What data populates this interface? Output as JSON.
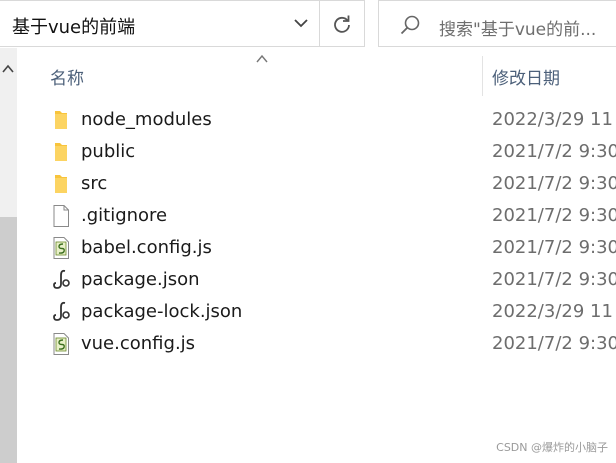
{
  "address_bar": {
    "path": "基于vue的前端",
    "dropdown_icon": "chevron-down-icon",
    "refresh_icon": "refresh-icon"
  },
  "search": {
    "placeholder": "搜索\"基于vue的前...",
    "icon": "search-icon"
  },
  "columns": {
    "name": "名称",
    "date_modified": "修改日期",
    "sorted_by": "name",
    "sort_direction": "ascending"
  },
  "files": [
    {
      "name": "node_modules",
      "date": "2022/3/29 11",
      "type": "folder"
    },
    {
      "name": "public",
      "date": "2021/7/2 9:30",
      "type": "folder"
    },
    {
      "name": "src",
      "date": "2021/7/2 9:30",
      "type": "folder"
    },
    {
      "name": ".gitignore",
      "date": "2021/7/2 9:30",
      "type": "file"
    },
    {
      "name": "babel.config.js",
      "date": "2021/7/2 9:30",
      "type": "js"
    },
    {
      "name": "package.json",
      "date": "2021/7/2 9:30",
      "type": "json"
    },
    {
      "name": "package-lock.json",
      "date": "2022/3/29 11",
      "type": "json"
    },
    {
      "name": "vue.config.js",
      "date": "2021/7/2 9:30",
      "type": "js"
    }
  ],
  "watermark": "CSDN @爆炸的小脑子",
  "colors": {
    "folder": "#f8c43c",
    "header_text": "#4c607a",
    "date_text": "#6d6d6d",
    "border": "#d9d9d9",
    "scrollbar": "#cdcdcd"
  }
}
